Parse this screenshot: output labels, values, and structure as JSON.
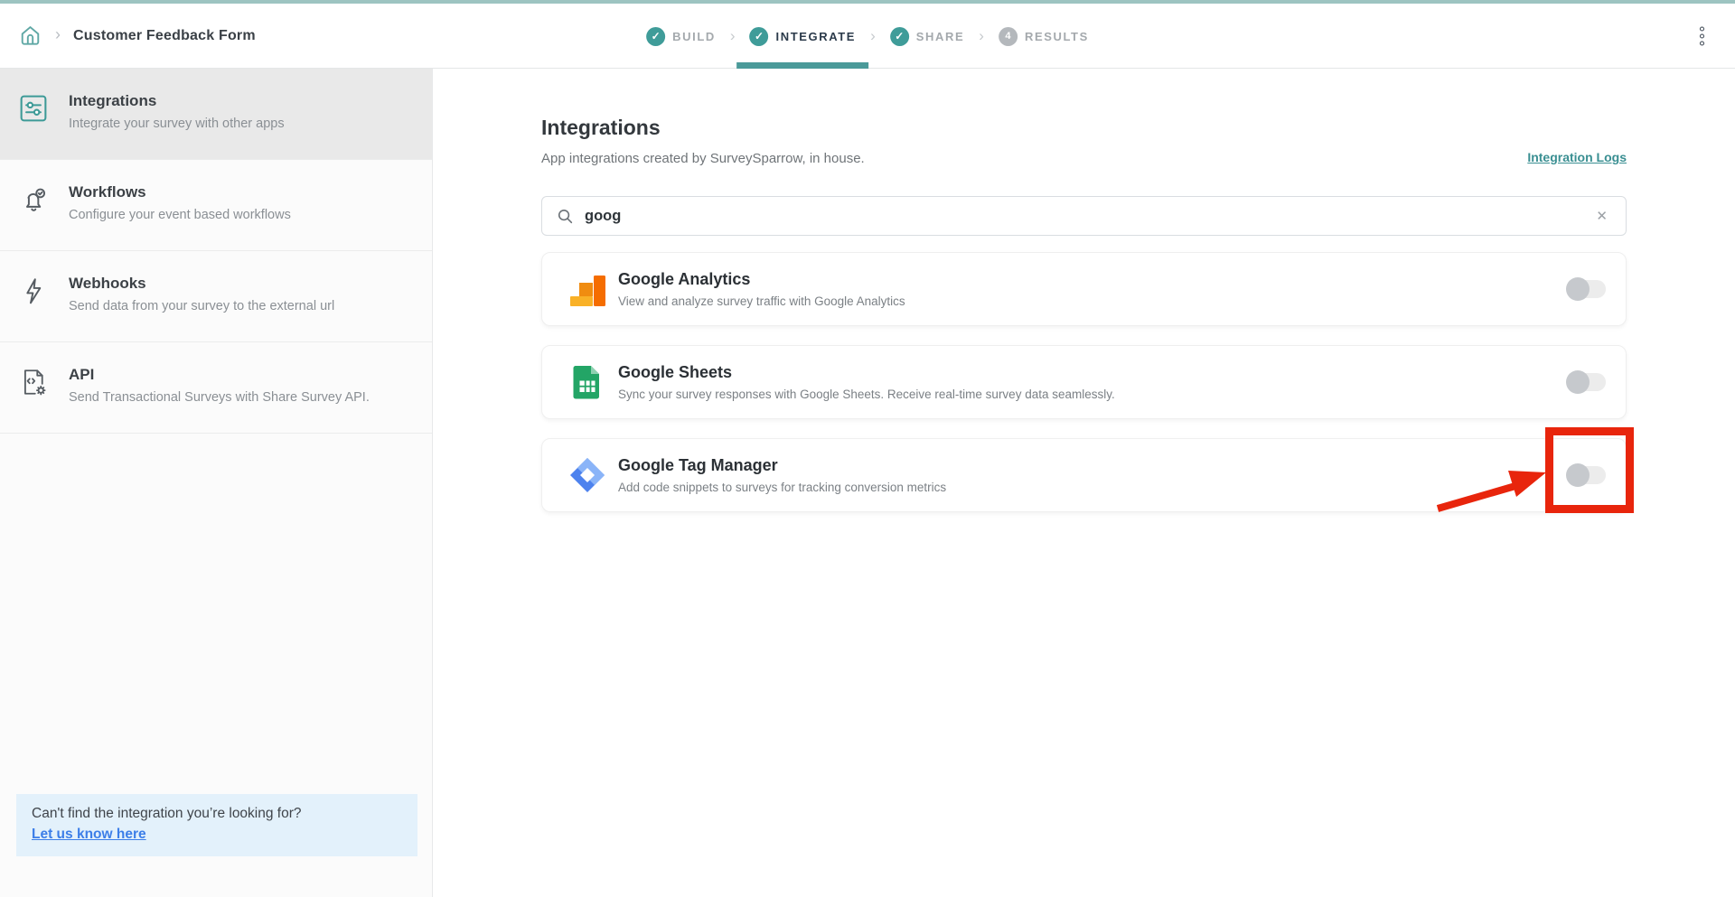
{
  "topbar": {
    "breadcrumb": "Customer Feedback Form",
    "home_icon": "home-icon",
    "menu_icon": "kebab-menu-icon",
    "steps": [
      {
        "label": "BUILD",
        "state": "done"
      },
      {
        "label": "INTEGRATE",
        "state": "active"
      },
      {
        "label": "SHARE",
        "state": "done"
      },
      {
        "label": "RESULTS",
        "state": "upcoming",
        "number": "4"
      }
    ]
  },
  "sidebar": {
    "items": [
      {
        "title": "Integrations",
        "description": "Integrate your survey with other apps",
        "icon": "sliders-icon",
        "active": true
      },
      {
        "title": "Workflows",
        "description": "Configure your event based workflows",
        "icon": "bell-check-icon",
        "active": false
      },
      {
        "title": "Webhooks",
        "description": "Send data from your survey to the external url",
        "icon": "lightning-icon",
        "active": false
      },
      {
        "title": "API",
        "description": "Send Transactional Surveys with Share Survey API.",
        "icon": "code-doc-gear-icon",
        "active": false
      }
    ],
    "promo": {
      "question": "Can't find the integration you’re looking for?",
      "link": "Let us know here"
    }
  },
  "main": {
    "title": "Integrations",
    "subtitle": "App integrations created by SurveySparrow, in house.",
    "logs_link": "Integration Logs",
    "search": {
      "value": "goog",
      "icon": "search-icon",
      "clear_icon": "close-icon"
    },
    "cards": [
      {
        "name": "Google Analytics",
        "description": "View and analyze survey traffic with Google Analytics",
        "logo": "google-analytics-logo",
        "toggle": "off"
      },
      {
        "name": "Google Sheets",
        "description": "Sync your survey responses with Google Sheets. Receive real-time survey data seamlessly.",
        "logo": "google-sheets-logo",
        "toggle": "off"
      },
      {
        "name": "Google Tag Manager",
        "description": "Add code snippets to surveys for tracking conversion metrics",
        "logo": "google-tag-manager-logo",
        "toggle": "off",
        "highlighted": true
      }
    ]
  },
  "annotation": {
    "shape": "red-rectangle-and-arrow",
    "target": "google-tag-manager-toggle",
    "color": "#e8250c"
  },
  "colors": {
    "accent_teal": "#4a9a99",
    "top_strip": "#9dc4c1",
    "link_teal": "#3a8f92",
    "link_blue": "#3c7ee8",
    "promo_bg": "#e3f1fb",
    "active_item_bg": "#e9e9e9",
    "highlight_red": "#e8250c"
  }
}
